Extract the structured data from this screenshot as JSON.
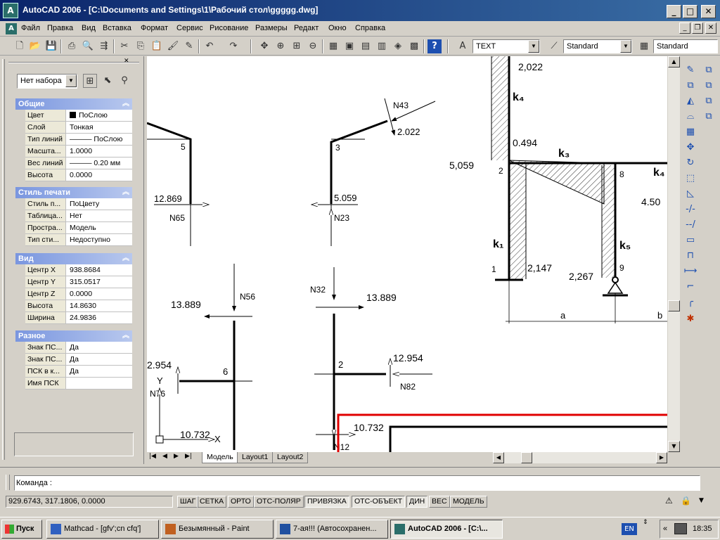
{
  "window": {
    "app_icon": "A",
    "title": "AutoCAD 2006 - [C:\\Documents and Settings\\1\\Рабочий стол\\ggggg.dwg]",
    "minimize": "_",
    "maximize": "□",
    "close": "✕"
  },
  "menu": {
    "items": [
      "Файл",
      "Правка",
      "Вид",
      "Вставка",
      "Формат",
      "Сервис",
      "Рисование",
      "Размеры",
      "Редакт",
      "Окно",
      "Справка"
    ]
  },
  "toolbar": {
    "text_style": "TEXT",
    "dim_style": "Standard",
    "table_style": "Standard"
  },
  "properties": {
    "selection": "Нет набора",
    "sections": [
      {
        "title": "Общие",
        "rows": [
          {
            "k": "Цвет",
            "v": "ПоСлою"
          },
          {
            "k": "Слой",
            "v": "Тонкая"
          },
          {
            "k": "Тип линий",
            "v": "——— ПоСлою"
          },
          {
            "k": "Масшта...",
            "v": "1.0000"
          },
          {
            "k": "Вес линий",
            "v": "——— 0.20 мм"
          },
          {
            "k": "Высота",
            "v": "0.0000"
          }
        ]
      },
      {
        "title": "Стиль печати",
        "rows": [
          {
            "k": "Стиль п...",
            "v": "ПоЦвету"
          },
          {
            "k": "Таблица...",
            "v": "Нет"
          },
          {
            "k": "Простра...",
            "v": "Модель"
          },
          {
            "k": "Тип сти...",
            "v": "Недоступно"
          }
        ]
      },
      {
        "title": "Вид",
        "rows": [
          {
            "k": "Центр X",
            "v": "938.8684"
          },
          {
            "k": "Центр Y",
            "v": "315.0517"
          },
          {
            "k": "Центр Z",
            "v": "0.0000"
          },
          {
            "k": "Высота",
            "v": "14.8630"
          },
          {
            "k": "Ширина",
            "v": "24.9836"
          }
        ]
      },
      {
        "title": "Разное",
        "rows": [
          {
            "k": "Знак ПС...",
            "v": "Да"
          },
          {
            "k": "Знак ПС...",
            "v": "Да"
          },
          {
            "k": "ПСК в к...",
            "v": "Да"
          },
          {
            "k": "Имя ПСК",
            "v": ""
          }
        ]
      }
    ]
  },
  "drawing": {
    "labels": {
      "n5": "5",
      "n65": "N65",
      "v12869": "12.869",
      "n3": "3",
      "n43": "N43",
      "v2022a": "2.022",
      "v5059a": "5.059",
      "n23": "N23",
      "v2022b": "2,022",
      "k4": "k₄",
      "v0494": "0.494",
      "k3": "k₃",
      "v5059b": "5,059",
      "n2a": "2",
      "n8": "8",
      "k4b": "k₄",
      "v450": "4.50",
      "k1": "k₁",
      "k5": "k₅",
      "n1": "1",
      "v2147": "2,147",
      "n9": "9",
      "v2267": "2,267",
      "dim_a": "a",
      "dim_b": "b",
      "n56": "N56",
      "v13889a": "13.889",
      "n32": "N32",
      "v13889b": "13.889",
      "v2954": "2.954",
      "n6": "6",
      "n76": "N76",
      "n2b": "2",
      "v12954": "12.954",
      "n82": "N82",
      "v10732a": "10.732",
      "v10732b": "10.732",
      "n12": "N12",
      "ucs_y": "Y",
      "ucs_x": "X"
    }
  },
  "layout_tabs": [
    "Модель",
    "Layout1",
    "Layout2"
  ],
  "command": {
    "prompt": "Команда :"
  },
  "status": {
    "coords": "929.6743, 317.1806, 0.0000",
    "buttons": [
      "ШАГ",
      "СЕТКА",
      "ОРТО",
      "ОТС-ПОЛЯР",
      "ПРИВЯЗКА",
      "ОТС-ОБЪЕКТ",
      "ДИН",
      "ВЕС",
      "МОДЕЛЬ"
    ]
  },
  "taskbar": {
    "start": "Пуск",
    "tasks": [
      "Mathcad - [gfv';cn cfq']",
      "Безымянный - Paint",
      "7-ая!!! (Автосохранен...",
      "AutoCAD 2006 - [C:\\..."
    ],
    "lang": "EN",
    "time": "18:35"
  }
}
